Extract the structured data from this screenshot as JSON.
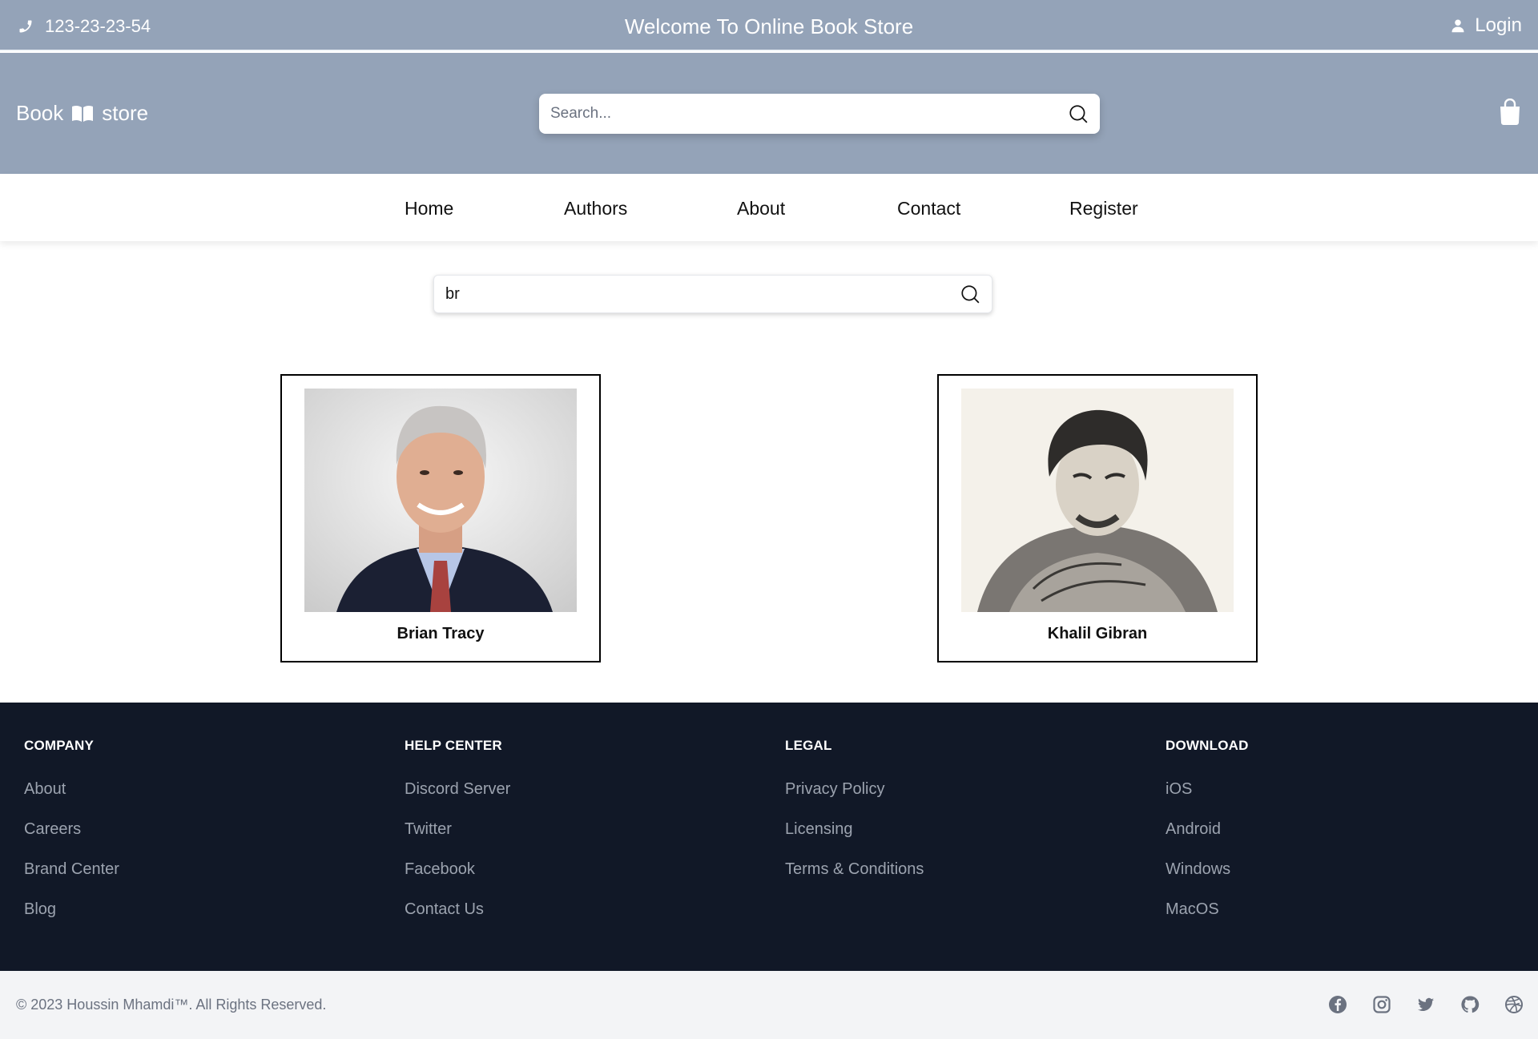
{
  "topbar": {
    "phone": "123-23-23-54",
    "welcome": "Welcome To Online Book Store",
    "login": "Login"
  },
  "header": {
    "brand_left": "Book",
    "brand_right": "store",
    "search_placeholder": "Search..."
  },
  "nav": {
    "items": [
      "Home",
      "Authors",
      "About",
      "Contact",
      "Register"
    ]
  },
  "author_search": {
    "value": "br"
  },
  "authors": [
    {
      "name": "Brian Tracy"
    },
    {
      "name": "Khalil Gibran"
    }
  ],
  "footer": {
    "columns": [
      {
        "title": "COMPANY",
        "links": [
          "About",
          "Careers",
          "Brand Center",
          "Blog"
        ]
      },
      {
        "title": "HELP CENTER",
        "links": [
          "Discord Server",
          "Twitter",
          "Facebook",
          "Contact Us"
        ]
      },
      {
        "title": "LEGAL",
        "links": [
          "Privacy Policy",
          "Licensing",
          "Terms & Conditions"
        ]
      },
      {
        "title": "DOWNLOAD",
        "links": [
          "iOS",
          "Android",
          "Windows",
          "MacOS"
        ]
      }
    ],
    "copyright": "© 2023 Houssin Mhamdi™. All Rights Reserved.",
    "socials": [
      "facebook-icon",
      "instagram-icon",
      "twitter-icon",
      "github-icon",
      "dribbble-icon"
    ]
  },
  "colors": {
    "header_bg": "#94a3b8",
    "footer_bg": "#111827",
    "bottom_bg": "#f3f4f6",
    "footer_link": "#9ca3af"
  }
}
